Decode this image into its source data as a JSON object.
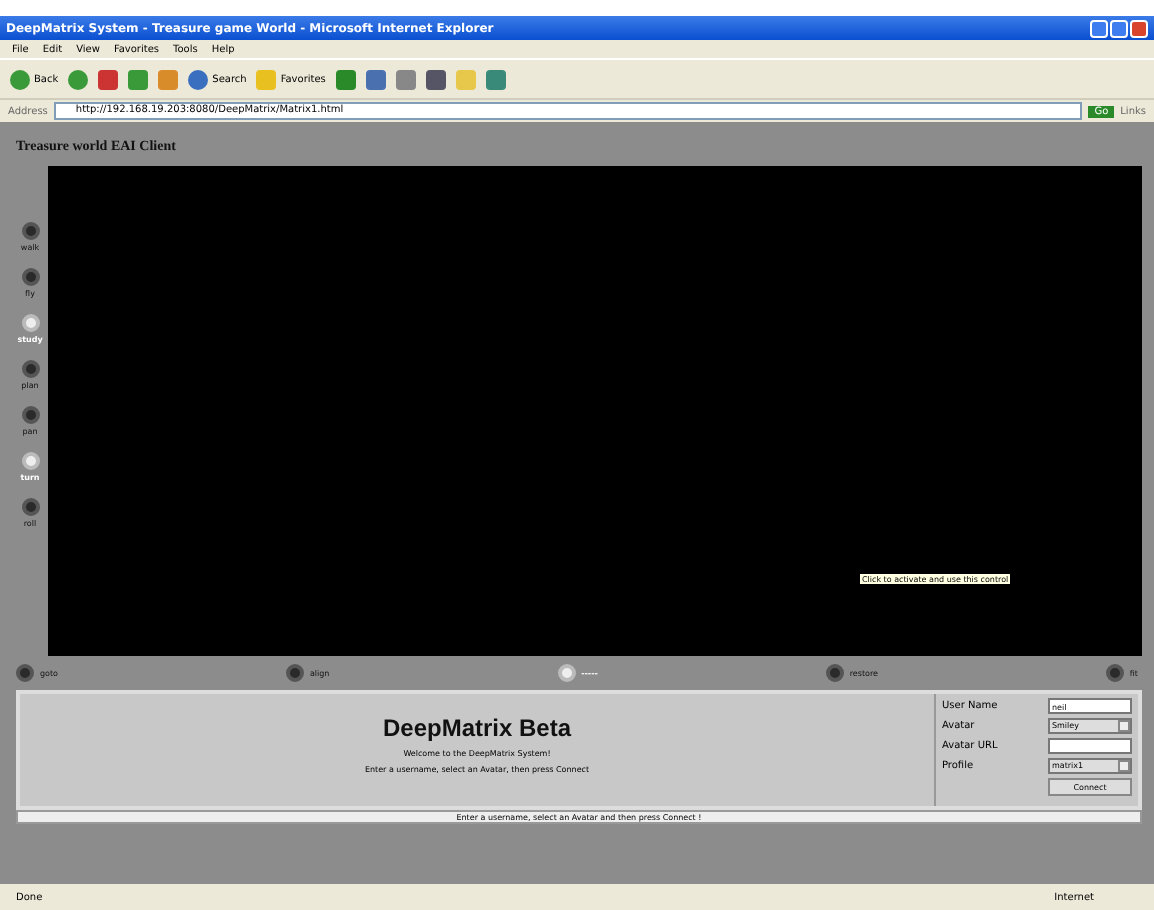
{
  "window": {
    "title": "DeepMatrix System - Treasure game World - Microsoft Internet Explorer"
  },
  "menu": [
    "File",
    "Edit",
    "View",
    "Favorites",
    "Tools",
    "Help"
  ],
  "toolbar": [
    {
      "kind": "back",
      "label": "Back"
    },
    {
      "kind": "forward"
    },
    {
      "kind": "stop"
    },
    {
      "kind": "refresh"
    },
    {
      "kind": "home"
    },
    {
      "kind": "search",
      "label": "Search"
    },
    {
      "kind": "favorites",
      "label": "Favorites"
    },
    {
      "kind": "media"
    },
    {
      "kind": "mail"
    },
    {
      "kind": "print"
    },
    {
      "kind": "edit"
    },
    {
      "kind": "folder"
    },
    {
      "kind": "messenger"
    }
  ],
  "address": {
    "label": "Address",
    "value": "http://192.168.19.203:8080/DeepMatrix/Matrix1.html",
    "go": "Go",
    "links": "Links"
  },
  "page_title": "Treasure world EAI Client",
  "side_controls": [
    {
      "label": "walk",
      "active": false
    },
    {
      "label": "fly",
      "active": false
    },
    {
      "label": "study",
      "active": true
    },
    {
      "label": "plan",
      "active": false
    },
    {
      "label": "pan",
      "active": false
    },
    {
      "label": "turn",
      "active": true
    },
    {
      "label": "roll",
      "active": false
    }
  ],
  "bottom_controls": [
    {
      "label": "goto",
      "active": false
    },
    {
      "label": "align",
      "active": false
    },
    {
      "label": "-----",
      "active": true
    },
    {
      "label": "restore",
      "active": false
    },
    {
      "label": "fit",
      "active": false
    }
  ],
  "tooltip": "Click to activate and use this control",
  "panel": {
    "heading": "DeepMatrix Beta",
    "welcome": "Welcome to the DeepMatrix System!",
    "instructions": "Enter a username, select an Avatar, then press Connect"
  },
  "form": [
    {
      "kind": "text",
      "label": "User Name",
      "value": "neil"
    },
    {
      "kind": "select",
      "label": "Avatar",
      "value": "Smiley"
    },
    {
      "kind": "text",
      "label": "Avatar URL"
    },
    {
      "kind": "select",
      "label": "Profile",
      "value": "matrix1"
    }
  ],
  "connect": "Connect",
  "status_line": "Enter a username, select an Avatar and then press Connect !",
  "status_bar": {
    "text": "Done",
    "zone": "Internet"
  }
}
